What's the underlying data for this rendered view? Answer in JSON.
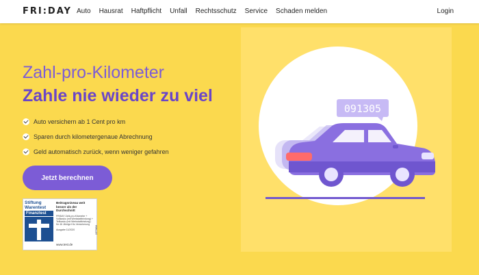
{
  "nav": {
    "logo": "FRI:DAY",
    "links": [
      "Auto",
      "Hausrat",
      "Haftpflicht",
      "Unfall",
      "Rechtsschutz",
      "Service",
      "Schaden melden"
    ],
    "login": "Login"
  },
  "hero": {
    "headline1": "Zahl-pro-Kilometer",
    "headline2": "Zahle nie wieder zu viel",
    "bullets": [
      "Auto versichern ab 1 Cent pro km",
      "Sparen durch kilometergenaue Abrechnung",
      "Geld automatisch zurück, wenn weniger gefahren"
    ],
    "cta": "Jetzt berechnen",
    "odometer": "091305"
  },
  "badge": {
    "org_line1": "Stiftung",
    "org_line2": "Warentest",
    "brand": "Finanztest",
    "title": "Beitragsniveau weit besser als der Durchschnitt",
    "text": "FRIDAY Zahl-pro-Kilometer + Vollkasko (mit Werkstattbindung) + Teilkasko (mit Werkstattbindung) für 46 Jährige Kfz-Versicherung",
    "issue": "Ausgabe 11/2020",
    "url": "www.test.de",
    "code": "2ZT9B9"
  },
  "colors": {
    "background": "#fbd94e",
    "accent": "#7c5cd6",
    "circle": "#ffffff",
    "car_body": "#8a6fe0"
  }
}
